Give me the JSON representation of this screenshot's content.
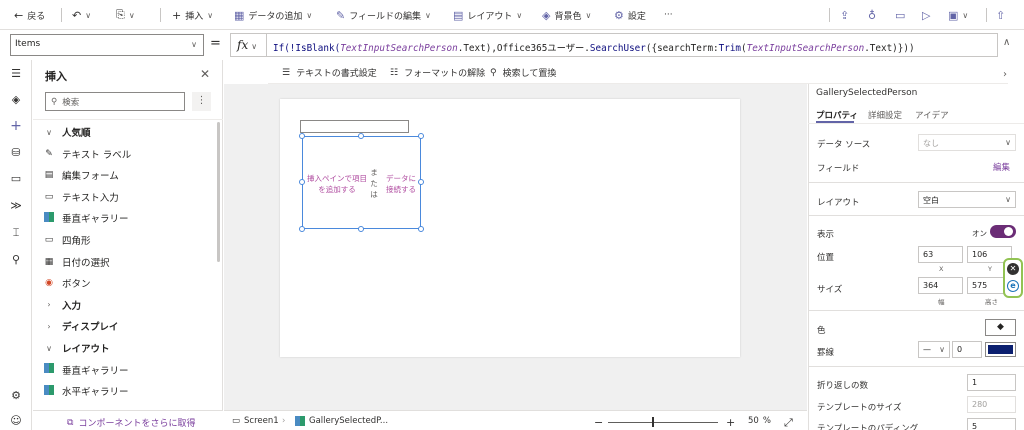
{
  "toolbar": {
    "back": "戻る",
    "insert": "挿入",
    "add_data": "データの追加",
    "edit_fields": "フィールドの編集",
    "layout": "レイアウト",
    "background": "背景色",
    "settings": "設定",
    "more": "···"
  },
  "formula_bar": {
    "property": "Items",
    "equals": "=",
    "fx": "fx",
    "formula_parts": [
      {
        "text": "If(!",
        "kind": "fn"
      },
      {
        "text": "IsBlank",
        "kind": "fn"
      },
      {
        "text": "(",
        "kind": "fn"
      },
      {
        "text": "TextInputSearchPerson",
        "kind": "ctl"
      },
      {
        "text": ".Text),Office365ユーザー.",
        "kind": "txt"
      },
      {
        "text": "SearchUser",
        "kind": "fn"
      },
      {
        "text": "({searchTerm:",
        "kind": "txt"
      },
      {
        "text": "Trim",
        "kind": "fn"
      },
      {
        "text": "(",
        "kind": "txt"
      },
      {
        "text": "TextInputSearchPerson",
        "kind": "ctl"
      },
      {
        "text": ".Text)}))",
        "kind": "txt"
      }
    ],
    "format_text": "テキストの書式設定",
    "remove_format": "フォーマットの解除",
    "find_replace": "検索して置換"
  },
  "insert_panel": {
    "title": "挿入",
    "search_placeholder": "検索",
    "items": [
      {
        "label": "人気順",
        "icon": "chevron-down-icon",
        "kind": "category"
      },
      {
        "label": "テキスト ラベル",
        "icon": "text-label-icon",
        "kind": "item"
      },
      {
        "label": "編集フォーム",
        "icon": "edit-form-icon",
        "kind": "item"
      },
      {
        "label": "テキスト入力",
        "icon": "text-input-icon",
        "kind": "item"
      },
      {
        "label": "垂直ギャラリー",
        "icon": "gallery-icon",
        "kind": "item"
      },
      {
        "label": "四角形",
        "icon": "rectangle-icon",
        "kind": "item"
      },
      {
        "label": "日付の選択",
        "icon": "calendar-icon",
        "kind": "item"
      },
      {
        "label": "ボタン",
        "icon": "button-icon",
        "kind": "item"
      },
      {
        "label": "入力",
        "icon": "chevron-right-icon",
        "kind": "category"
      },
      {
        "label": "ディスプレイ",
        "icon": "chevron-right-icon",
        "kind": "category"
      },
      {
        "label": "レイアウト",
        "icon": "chevron-down-icon",
        "kind": "category"
      },
      {
        "label": "垂直ギャラリー",
        "icon": "gallery-icon",
        "kind": "item"
      },
      {
        "label": "水平ギャラリー",
        "icon": "gallery-icon",
        "kind": "item"
      }
    ],
    "footer_link": "コンポーネントをさらに取得"
  },
  "canvas": {
    "gallery_left_text": "挿入ペインで項目を追加する",
    "gallery_or": "または",
    "gallery_right_text": "データに接続する"
  },
  "status_bar": {
    "screen": "Screen1",
    "selected": "GallerySelectedP...",
    "zoom_minus": "−",
    "zoom_plus": "+",
    "zoom_value": "50",
    "zoom_unit": "%"
  },
  "properties": {
    "control_name": "GallerySelectedPerson",
    "tabs": [
      "プロパティ",
      "詳細設定",
      "アイデア"
    ],
    "data_source_label": "データ ソース",
    "data_source_value": "なし",
    "fields_label": "フィールド",
    "fields_link": "編集",
    "layout_label": "レイアウト",
    "layout_value": "空白",
    "visible_label": "表示",
    "visible_value": "オン",
    "position_label": "位置",
    "position_x": "63",
    "position_y": "106",
    "x_caption": "X",
    "y_caption": "Y",
    "size_label": "サイズ",
    "width": "364",
    "height": "575",
    "width_caption": "幅",
    "height_caption": "高さ",
    "color_label": "色",
    "border_label": "罫線",
    "border_width": "0",
    "border_color": "#0b1f6f",
    "wrap_count_label": "折り返しの数",
    "wrap_count": "1",
    "template_size_label": "テンプレートのサイズ",
    "template_size": "280",
    "template_padding_label": "テンプレートのパディング",
    "template_padding": "5"
  }
}
